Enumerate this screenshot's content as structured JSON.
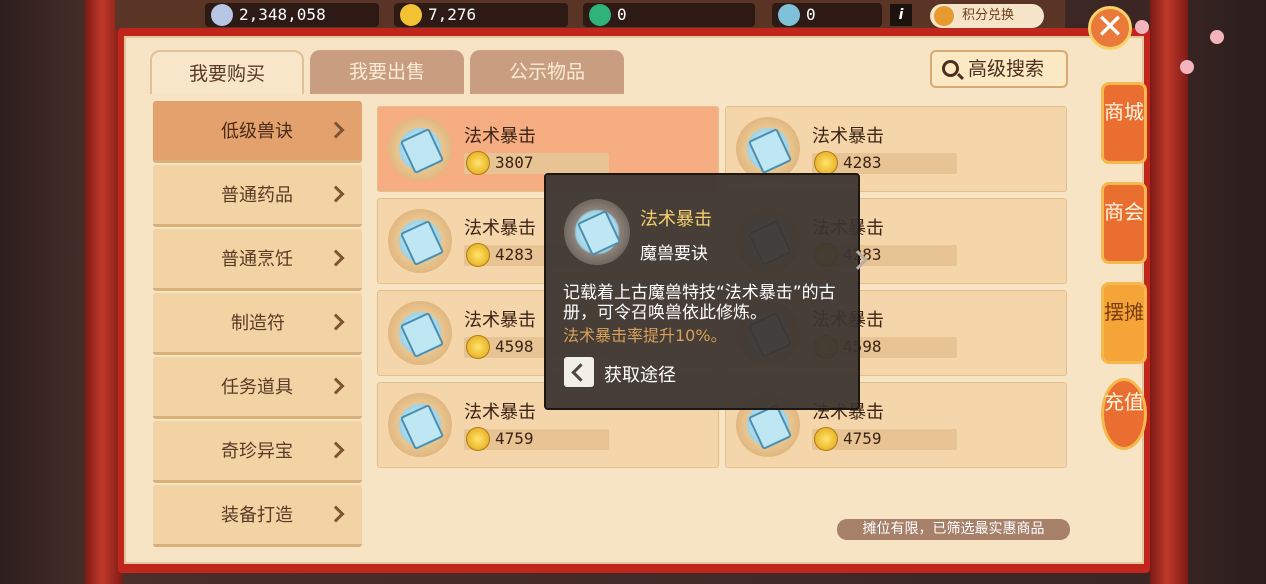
{
  "resources": [
    {
      "icon": "silver-coin-icon",
      "value": "2,348,058"
    },
    {
      "icon": "gold-coin-icon",
      "value": "7,276"
    },
    {
      "icon": "jade-icon",
      "value": "0"
    },
    {
      "icon": "fairy-icon",
      "value": "0"
    }
  ],
  "header": {
    "info_label": "i",
    "exchange_label": "积分兑换",
    "close_label": "✕"
  },
  "tabs": [
    {
      "label": "我要购买",
      "active": true
    },
    {
      "label": "我要出售",
      "active": false
    },
    {
      "label": "公示物品",
      "active": false
    }
  ],
  "search": {
    "label": "高级搜索"
  },
  "categories": [
    {
      "label": "低级兽诀",
      "active": true
    },
    {
      "label": "普通药品",
      "active": false
    },
    {
      "label": "普通烹饪",
      "active": false
    },
    {
      "label": "制造符",
      "active": false
    },
    {
      "label": "任务道具",
      "active": false
    },
    {
      "label": "奇珍异宝",
      "active": false
    },
    {
      "label": "装备打造",
      "active": false
    }
  ],
  "items": [
    {
      "name": "法术暴击",
      "price": "3807",
      "selected": true
    },
    {
      "name": "法术暴击",
      "price": "4283",
      "selected": false
    },
    {
      "name": "法术暴击",
      "price": "4283",
      "selected": false
    },
    {
      "name": "法术暴击",
      "price": "4283",
      "selected": false
    },
    {
      "name": "法术暴击",
      "price": "4598",
      "selected": false
    },
    {
      "name": "法术暴击",
      "price": "4598",
      "selected": false
    },
    {
      "name": "法术暴击",
      "price": "4759",
      "selected": false
    },
    {
      "name": "法术暴击",
      "price": "4759",
      "selected": false
    }
  ],
  "tooltip": {
    "title": "法术暴击",
    "type": "魔兽要诀",
    "description": "记载着上古魔兽特技“法术暴击”的古册，可令召唤兽依此修炼。",
    "effect": "法术暴击率提升10%。",
    "source_label": "获取途径"
  },
  "notice": "摊位有限，已筛选最实惠商品",
  "side_tabs": [
    {
      "label": "商城",
      "active": false
    },
    {
      "label": "商会",
      "active": false
    },
    {
      "label": "摆摊",
      "active": true
    },
    {
      "label": "充值",
      "active": false
    }
  ],
  "colors": {
    "frame_red": "#c0261c",
    "panel_bg": "#f6e4c4",
    "active_item": "#f5ad81",
    "gold_text": "#f4d06f",
    "effect_text": "#d9a05c"
  }
}
